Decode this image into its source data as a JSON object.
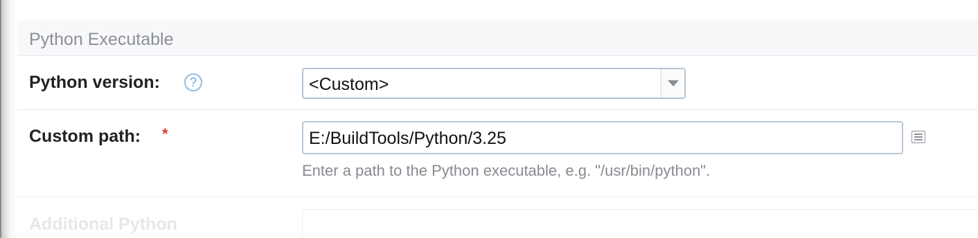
{
  "section": {
    "title": "Python Executable"
  },
  "python_version": {
    "label": "Python version:",
    "help_glyph": "?",
    "selected": "<Custom>"
  },
  "custom_path": {
    "label": "Custom path:",
    "required_mark": "*",
    "value": "E:/BuildTools/Python/3.25",
    "hint": "Enter a path to the Python executable, e.g. \"/usr/bin/python\"."
  },
  "additional": {
    "label": "Additional Python"
  },
  "icons": {
    "help": "question-circle-icon",
    "dropdown": "chevron-down-icon",
    "picker": "list-icon"
  },
  "colors": {
    "required": "#d83a3a",
    "help": "#6aa6dd",
    "hint": "#878b91"
  }
}
